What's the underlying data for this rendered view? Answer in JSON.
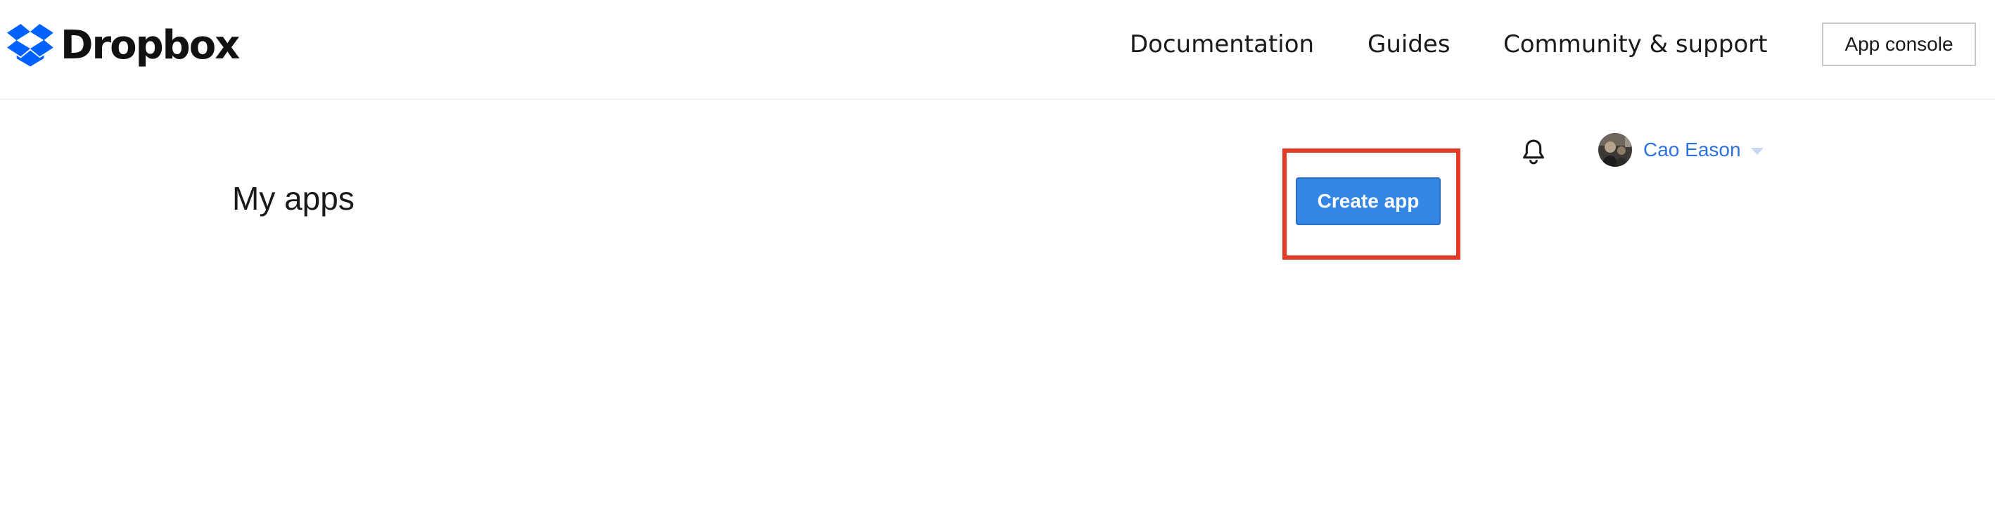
{
  "header": {
    "brand": "Dropbox",
    "nav": {
      "documentation": "Documentation",
      "guides": "Guides",
      "community": "Community & support"
    },
    "app_console_label": "App console"
  },
  "user": {
    "name": "Cao Eason",
    "avatar_icon": "user-avatar-photo",
    "notification_icon": "bell-icon",
    "menu_icon": "chevron-down-icon"
  },
  "main": {
    "title": "My apps",
    "create_app_label": "Create app"
  },
  "colors": {
    "brand_blue": "#0061fe",
    "primary_button": "#3486e5",
    "link_blue": "#2e72db",
    "highlight_red": "#e43a25"
  }
}
